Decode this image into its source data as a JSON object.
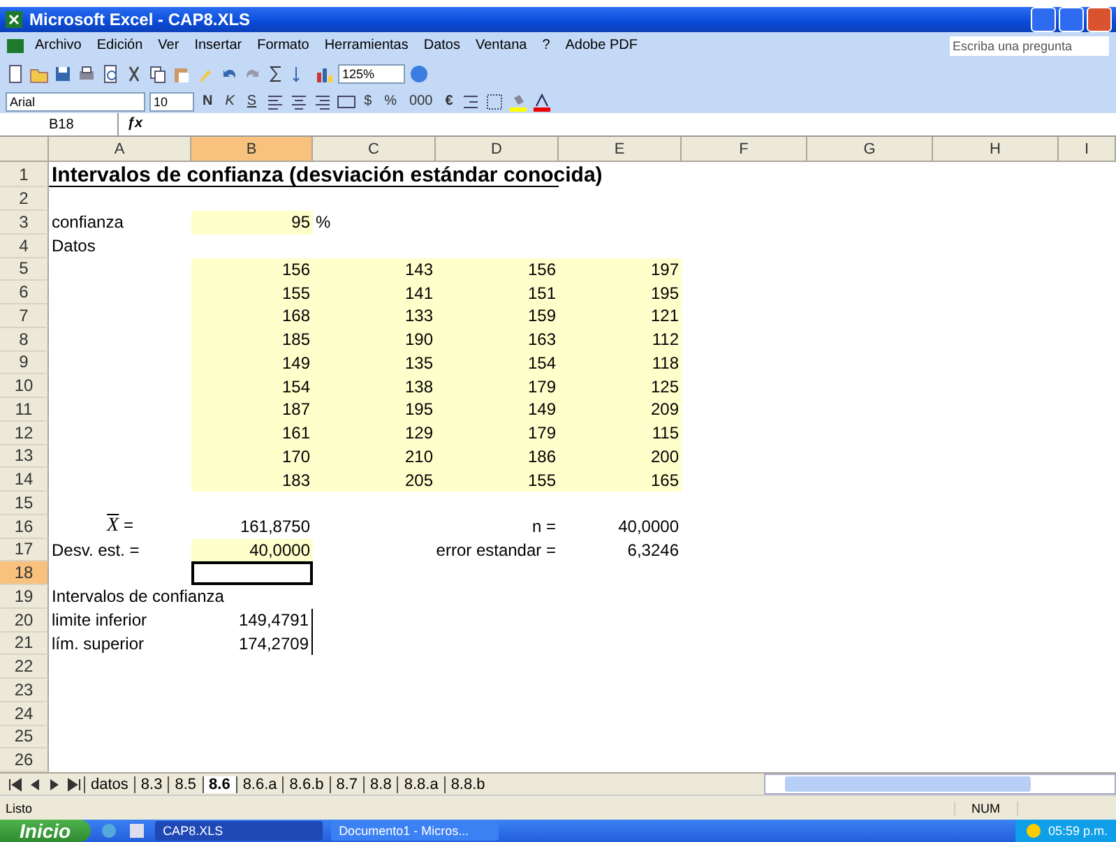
{
  "window": {
    "title": "Microsoft Excel - CAP8.XLS"
  },
  "menu": [
    "Archivo",
    "Edición",
    "Ver",
    "Insertar",
    "Formato",
    "Herramientas",
    "Datos",
    "Ventana",
    "?",
    "Adobe PDF"
  ],
  "help_search": {
    "placeholder": "Escriba una pregunta"
  },
  "standard_toolbar": {
    "zoom": "125%"
  },
  "format_toolbar": {
    "font": "Arial",
    "size": "10",
    "bold": "N",
    "italic": "K",
    "underline": "S",
    "currency": "$",
    "percent": "%",
    "thousands": "000",
    "euro": "€"
  },
  "formula_bar": {
    "cell": "B18",
    "function_label": "ƒx"
  },
  "columns": [
    {
      "label": "A",
      "selected": false
    },
    {
      "label": "B",
      "selected": true
    },
    {
      "label": "C",
      "selected": false
    },
    {
      "label": "D",
      "selected": false
    },
    {
      "label": "E",
      "selected": false
    },
    {
      "label": "F",
      "selected": false
    },
    {
      "label": "G",
      "selected": false
    },
    {
      "label": "H",
      "selected": false
    },
    {
      "label": "I",
      "selected": false
    }
  ],
  "rows": [
    {
      "header": "1",
      "selected": false,
      "cells": {
        "a": {
          "kind": "title",
          "text": "Intervalos de confianza  (desviación estándar conocida)"
        }
      }
    },
    {
      "header": "2",
      "selected": false,
      "cells": {}
    },
    {
      "header": "3",
      "selected": false,
      "cells": {
        "a": {
          "kind": "label",
          "text": "confianza"
        },
        "b": {
          "kind": "number",
          "text": "95",
          "highlighted": true
        },
        "c": {
          "kind": "label",
          "text": "%"
        }
      }
    },
    {
      "header": "4",
      "selected": false,
      "cells": {
        "a": {
          "kind": "label",
          "text": "Datos"
        }
      }
    },
    {
      "header": "5",
      "selected": false,
      "cells": {
        "b": {
          "kind": "number",
          "text": "156",
          "highlighted": true
        },
        "c": {
          "kind": "number",
          "text": "143",
          "highlighted": true
        },
        "d": {
          "kind": "number",
          "text": "156",
          "highlighted": true
        },
        "e": {
          "kind": "number",
          "text": "197",
          "highlighted": true
        }
      }
    },
    {
      "header": "6",
      "selected": false,
      "cells": {
        "b": {
          "kind": "number",
          "text": "155",
          "highlighted": true
        },
        "c": {
          "kind": "number",
          "text": "141",
          "highlighted": true
        },
        "d": {
          "kind": "number",
          "text": "151",
          "highlighted": true
        },
        "e": {
          "kind": "number",
          "text": "195",
          "highlighted": true
        }
      }
    },
    {
      "header": "7",
      "selected": false,
      "cells": {
        "b": {
          "kind": "number",
          "text": "168",
          "highlighted": true
        },
        "c": {
          "kind": "number",
          "text": "133",
          "highlighted": true
        },
        "d": {
          "kind": "number",
          "text": "159",
          "highlighted": true
        },
        "e": {
          "kind": "number",
          "text": "121",
          "highlighted": true
        }
      }
    },
    {
      "header": "8",
      "selected": false,
      "cells": {
        "b": {
          "kind": "number",
          "text": "185",
          "highlighted": true
        },
        "c": {
          "kind": "number",
          "text": "190",
          "highlighted": true
        },
        "d": {
          "kind": "number",
          "text": "163",
          "highlighted": true
        },
        "e": {
          "kind": "number",
          "text": "112",
          "highlighted": true
        }
      }
    },
    {
      "header": "9",
      "selected": false,
      "cells": {
        "b": {
          "kind": "number",
          "text": "149",
          "highlighted": true
        },
        "c": {
          "kind": "number",
          "text": "135",
          "highlighted": true
        },
        "d": {
          "kind": "number",
          "text": "154",
          "highlighted": true
        },
        "e": {
          "kind": "number",
          "text": "118",
          "highlighted": true
        }
      }
    },
    {
      "header": "10",
      "selected": false,
      "cells": {
        "b": {
          "kind": "number",
          "text": "154",
          "highlighted": true
        },
        "c": {
          "kind": "number",
          "text": "138",
          "highlighted": true
        },
        "d": {
          "kind": "number",
          "text": "179",
          "highlighted": true
        },
        "e": {
          "kind": "number",
          "text": "125",
          "highlighted": true
        }
      }
    },
    {
      "header": "11",
      "selected": false,
      "cells": {
        "b": {
          "kind": "number",
          "text": "187",
          "highlighted": true
        },
        "c": {
          "kind": "number",
          "text": "195",
          "highlighted": true
        },
        "d": {
          "kind": "number",
          "text": "149",
          "highlighted": true
        },
        "e": {
          "kind": "number",
          "text": "209",
          "highlighted": true
        }
      }
    },
    {
      "header": "12",
      "selected": false,
      "cells": {
        "b": {
          "kind": "number",
          "text": "161",
          "highlighted": true
        },
        "c": {
          "kind": "number",
          "text": "129",
          "highlighted": true
        },
        "d": {
          "kind": "number",
          "text": "179",
          "highlighted": true
        },
        "e": {
          "kind": "number",
          "text": "115",
          "highlighted": true
        }
      }
    },
    {
      "header": "13",
      "selected": false,
      "cells": {
        "b": {
          "kind": "number",
          "text": "170",
          "highlighted": true
        },
        "c": {
          "kind": "number",
          "text": "210",
          "highlighted": true
        },
        "d": {
          "kind": "number",
          "text": "186",
          "highlighted": true
        },
        "e": {
          "kind": "number",
          "text": "200",
          "highlighted": true
        }
      }
    },
    {
      "header": "14",
      "selected": false,
      "cells": {
        "b": {
          "kind": "number",
          "text": "183",
          "highlighted": true
        },
        "c": {
          "kind": "number",
          "text": "205",
          "highlighted": true
        },
        "d": {
          "kind": "number",
          "text": "155",
          "highlighted": true
        },
        "e": {
          "kind": "number",
          "text": "165",
          "highlighted": true
        }
      }
    },
    {
      "header": "15",
      "selected": false,
      "cells": {}
    },
    {
      "header": "16",
      "selected": false,
      "cells": {
        "a": {
          "kind": "mean",
          "symbol": "X",
          "text": " ="
        },
        "b": {
          "kind": "number",
          "text": "161,8750"
        },
        "d": {
          "kind": "number",
          "text": "n ="
        },
        "e": {
          "kind": "number",
          "text": "40,0000"
        }
      }
    },
    {
      "header": "17",
      "selected": false,
      "cells": {
        "a": {
          "kind": "label",
          "text": "Desv. est. ="
        },
        "b": {
          "kind": "number",
          "text": "40,0000",
          "highlighted": true
        },
        "d": {
          "kind": "number",
          "text": "error estandar ="
        },
        "e": {
          "kind": "number",
          "text": "6,3246"
        }
      }
    },
    {
      "header": "18",
      "selected": true,
      "cells": {
        "b": {
          "kind": "active"
        }
      }
    },
    {
      "header": "19",
      "selected": false,
      "cells": {
        "a": {
          "kind": "label",
          "text": "Intervalos de confianza"
        }
      }
    },
    {
      "header": "20",
      "selected": false,
      "cells": {
        "a": {
          "kind": "label",
          "text": "limite inferior"
        },
        "b": {
          "kind": "number",
          "text": "149,4791",
          "bordered": true
        }
      }
    },
    {
      "header": "21",
      "selected": false,
      "cells": {
        "a": {
          "kind": "label",
          "text": "lím. superior"
        },
        "b": {
          "kind": "number",
          "text": "174,2709",
          "bordered": true
        }
      }
    },
    {
      "header": "22",
      "selected": false,
      "cells": {}
    },
    {
      "header": "23",
      "selected": false,
      "cells": {}
    },
    {
      "header": "24",
      "selected": false,
      "cells": {}
    },
    {
      "header": "25",
      "selected": false,
      "cells": {}
    },
    {
      "header": "26",
      "selected": false,
      "cells": {}
    }
  ],
  "sheet_tabs": [
    {
      "label": "datos",
      "selected": false
    },
    {
      "label": "8.3",
      "selected": false
    },
    {
      "label": "8.5",
      "selected": false
    },
    {
      "label": "8.6",
      "selected": true
    },
    {
      "label": "8.6.a",
      "selected": false
    },
    {
      "label": "8.6.b",
      "selected": false
    },
    {
      "label": "8.7",
      "selected": false
    },
    {
      "label": "8.8",
      "selected": false
    },
    {
      "label": "8.8.a",
      "selected": false
    },
    {
      "label": "8.8.b",
      "selected": false
    }
  ],
  "status_bar": {
    "status": "Listo",
    "num": "NUM"
  },
  "taskbar": {
    "start": "Inicio",
    "windows": [
      {
        "label": "CAP8.XLS",
        "selected": true
      },
      {
        "label": "Documento1 - Micros...",
        "selected": false
      }
    ],
    "clock": "05:59 p.m."
  }
}
